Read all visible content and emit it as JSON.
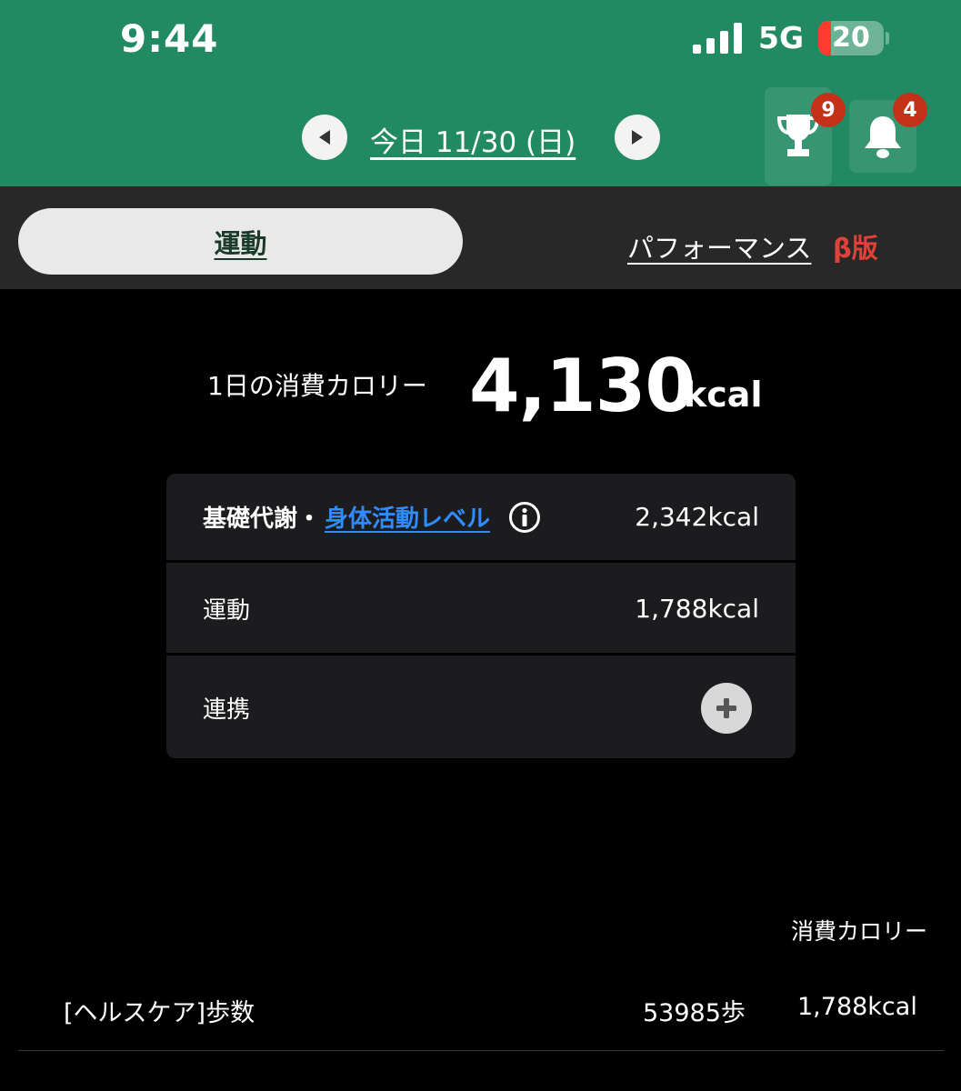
{
  "status_bar": {
    "time": "9:44",
    "network": "5G",
    "battery": "20",
    "battery_level": 0.2
  },
  "header": {
    "date_label": "今日 11/30 (日)",
    "prev_icon": "triangle-left",
    "next_icon": "triangle-right",
    "trophy_badge": "9",
    "bell_badge": "4",
    "colors": {
      "header_bg": "#218a62",
      "badge": "#c5301b"
    }
  },
  "tabs": {
    "active_label": "運動",
    "other_label": "パフォーマンス",
    "beta_label": "β版"
  },
  "summary": {
    "label": "1日の消費カロリー",
    "value": "4,130",
    "unit": "kcal"
  },
  "breakdown": {
    "row1": {
      "label": "基礎代謝・",
      "link": "身体活動レベル",
      "value": "2,342kcal"
    },
    "row2": {
      "label": "運動",
      "value": "1,788kcal"
    },
    "row3": {
      "label": "連携"
    },
    "link_color": "#2f8cff"
  },
  "list": {
    "column_header": "消費カロリー",
    "items": [
      {
        "name": "[ヘルスケア]歩数",
        "steps": "53985歩",
        "kcal": "1,788kcal"
      }
    ]
  }
}
